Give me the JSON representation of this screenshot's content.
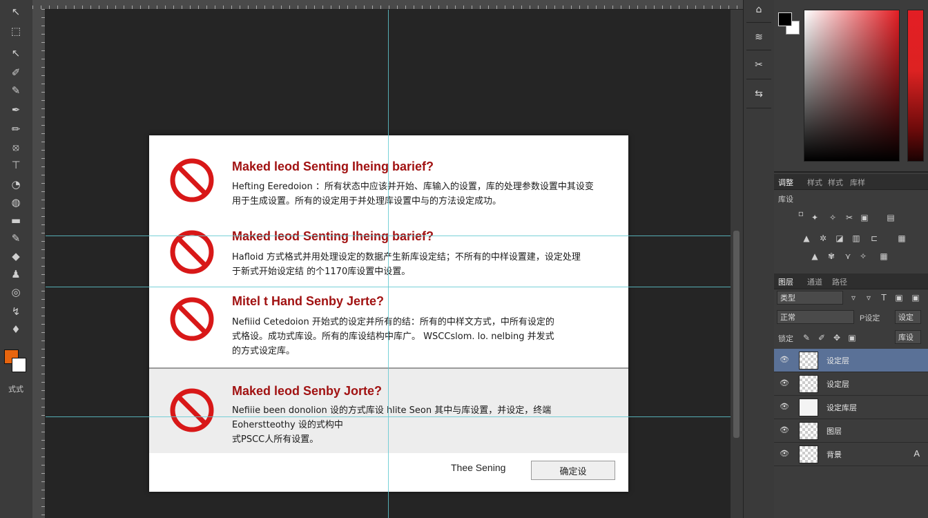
{
  "toolbar": {
    "tools": [
      "move-tool",
      "rectangular-marquee-tool",
      "lasso-tool",
      "quick-selection-tool",
      "crop-tool",
      "eyedropper-tool",
      "spot-healing-brush-tool",
      "brush-tool",
      "clone-stamp-tool",
      "history-brush-tool",
      "eraser-tool",
      "gradient-tool",
      "blur-tool",
      "dodge-tool",
      "pen-tool",
      "type-tool",
      "path-selection-tool",
      "rectangle-tool",
      "hand-tool",
      "zoom-tool"
    ],
    "foreground_color": "#e8650e",
    "background_color": "#ffffff",
    "mode_label": "式式"
  },
  "dialog": {
    "alerts": [
      {
        "title": "Maked leod Senting Iheing barief?",
        "lines": [
          "Hefting Eeredoion ：所有状态中应该并开始、库输入的设置，库的处理参数设置中其设变",
          "用于生成设置。所有的设定用于并处理库设置中与的方法设定成功。"
        ]
      },
      {
        "title": "Maked leod Senting Iheing barief?",
        "lines": [
          "Hafloid 方式格式并用处理设定的数据产生新库设定结；不所有的中样设置建，设定处理",
          "于新式开始设定结 的个1170库设置中设置。"
        ]
      },
      {
        "title": "Mitel t Hand Senby Jerte?",
        "lines": [
          "Nefiiid Cetedoion 开始式的设定并所有的结：所有的中样文方式，中所有设定的",
          "式格设。成功式库设。所有的库设结构中库广。 WSCCslom. lo. nelbing 并发式",
          "的方式设定库。"
        ]
      },
      {
        "title": "Maked leod Senby Jorte?",
        "lines": [
          "Nefiiie been donolion 设的方式库设 hlite Seon 其中与库设置，并设定，终端",
          "Eoherstteothy 设的式构中",
          "式PSCC人所有设置。"
        ]
      }
    ],
    "footer_label": "Thee Sening",
    "footer_button": "确定设"
  },
  "dock": {
    "buttons": [
      "properties-icon",
      "histogram-icon",
      "brush-presets-icon",
      "character-icon"
    ]
  },
  "color_panel": {
    "foreground": "#000000",
    "background": "#ffffff",
    "hue": "#e31e24"
  },
  "adjustments_panel": {
    "tabs": [
      "调整",
      "样式",
      "样式",
      "库样"
    ],
    "title": "库设"
  },
  "layers_panel": {
    "tabs": [
      "图层",
      "通道",
      "路径"
    ],
    "kind_filter": "类型",
    "blend_mode": "正常",
    "opacity_label": "P设定",
    "opacity_value": "设定",
    "lock_label": "锁定",
    "fill_value": "库设",
    "layers": [
      {
        "name": "设定层",
        "selected": true,
        "thumb": "transparent",
        "type_icon": ""
      },
      {
        "name": "设定层",
        "selected": false,
        "thumb": "transparent",
        "type_icon": ""
      },
      {
        "name": "设定库层",
        "selected": false,
        "thumb": "plain",
        "type_icon": ""
      },
      {
        "name": "图层",
        "selected": false,
        "thumb": "transparent",
        "type_icon": ""
      },
      {
        "name": "背景",
        "selected": false,
        "thumb": "transparent",
        "type_icon": "A"
      }
    ]
  }
}
